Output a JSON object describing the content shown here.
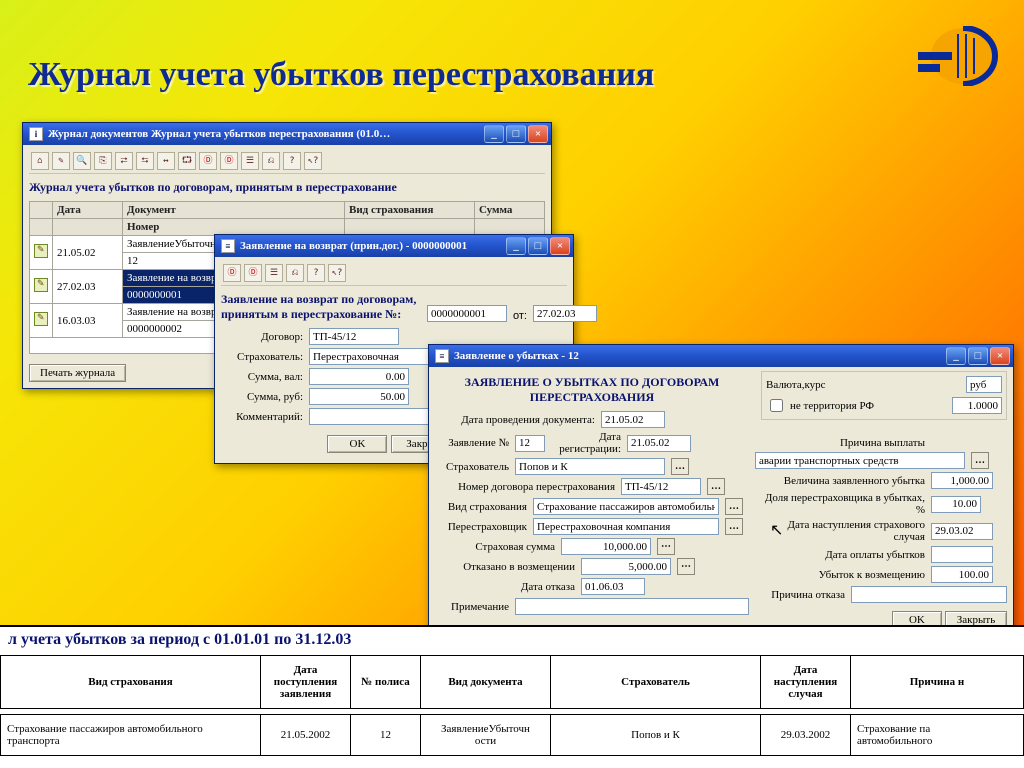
{
  "slide": {
    "title": "Журнал учета убытков перестрахования"
  },
  "win1": {
    "title": "Журнал документов  Журнал учета убытков перестрахования (01.0…",
    "section": "Журнал учета убытков по договорам, принятым в перестрахование",
    "cols": {
      "date": "Дата",
      "doc": "Документ",
      "num": "Номер",
      "kind": "Вид страхования",
      "sum": "Сумма"
    },
    "rows": [
      {
        "date": "21.05.02",
        "doc": "ЗаявлениеУбыточн",
        "num": "12"
      },
      {
        "date": "27.02.03",
        "doc": "Заявление на возвр",
        "num": "0000000001",
        "selected": true
      },
      {
        "date": "16.03.03",
        "doc": "Заявление на возвр",
        "num": "0000000002"
      }
    ],
    "print": "Печать журнала"
  },
  "win2": {
    "title": "Заявление на возврат (прин.дог.) - 0000000001",
    "heading": "Заявление на возврат по договорам,\nпринятым в перестрахование №:",
    "num": "0000000001",
    "from_lbl": "от:",
    "date": "27.02.03",
    "contract_lbl": "Договор:",
    "contract": "ТП-45/12",
    "insurer_lbl": "Страхователь:",
    "insurer": "Перестраховочная",
    "sumval_lbl": "Сумма, вал:",
    "sumval": "0.00",
    "sumrub_lbl": "Сумма, руб:",
    "sumrub": "50.00",
    "comment_lbl": "Комментарий:",
    "ok": "OK",
    "close": "Закрыть"
  },
  "win3": {
    "title": "Заявление о убытках - 12",
    "heading": "ЗАЯВЛЕНИЕ О УБЫТКАХ ПО ДОГОВОРАМ\nПЕРЕСТРАХОВАНИЯ",
    "valuta_box": "Валюта,курс",
    "check": "не территория РФ",
    "cur": "руб",
    "rate": "1.0000",
    "docdate_lbl": "Дата проведения документа:",
    "docdate": "21.05.02",
    "declnum_lbl": "Заявление №",
    "declnum": "12",
    "regdate_lbl": "Дата\nрегистрации:",
    "regdate": "21.05.02",
    "insurer_lbl": "Страхователь",
    "insurer": "Попов и К",
    "recontr_lbl": "Номер договора перестрахования",
    "recontr": "ТП-45/12",
    "kind_lbl": "Вид страхования",
    "kind": "Страхование пассажиров автомобильного",
    "reins_lbl": "Перестраховщик",
    "reins": "Перестраховочная компания",
    "ssum_lbl": "Страховая сумма",
    "ssum": "10,000.00",
    "denied_lbl": "Отказано в возмещении",
    "denied": "5,000.00",
    "deny_date_lbl": "Дата отказа",
    "deny_date": "01.06.03",
    "reason_pay_lbl": "Причина выплаты",
    "reason_pay": "аварии транспортных средств",
    "decl_loss_lbl": "Величина заявленного убытка",
    "decl_loss": "1,000.00",
    "share_lbl": "Доля перестраховщика в убытках, %",
    "share": "10.00",
    "event_date_lbl": "Дата наступления страхового случая",
    "event_date": "29.03.02",
    "paydate_lbl": "Дата оплаты убытков",
    "recov_lbl": "Убыток к возмещению",
    "recov": "100.00",
    "deny_reason_lbl": "Причина отказа",
    "note_lbl": "Примечание",
    "ok": "OK",
    "close": "Закрыть"
  },
  "report": {
    "title": "л учета убытков за период с 01.01.01 по 31.12.03",
    "cols": {
      "kind": "Вид страхования",
      "appdate": "Дата\nпоступления\nзаявления",
      "policy": "№ полиса",
      "doc": "Вид документа",
      "insurer": "Страхователь",
      "evdate": "Дата\nнаступления\nслучая",
      "cause": "Причина н"
    },
    "row": {
      "kind": "Страхование пассажиров автомобильного транспорта",
      "appdate": "21.05.2002",
      "policy": "12",
      "doc": "ЗаявлениеУбыточн\nости",
      "insurer": "Попов и К",
      "evdate": "29.03.2002",
      "cause": "Страхование па\nавтомобильного"
    }
  }
}
